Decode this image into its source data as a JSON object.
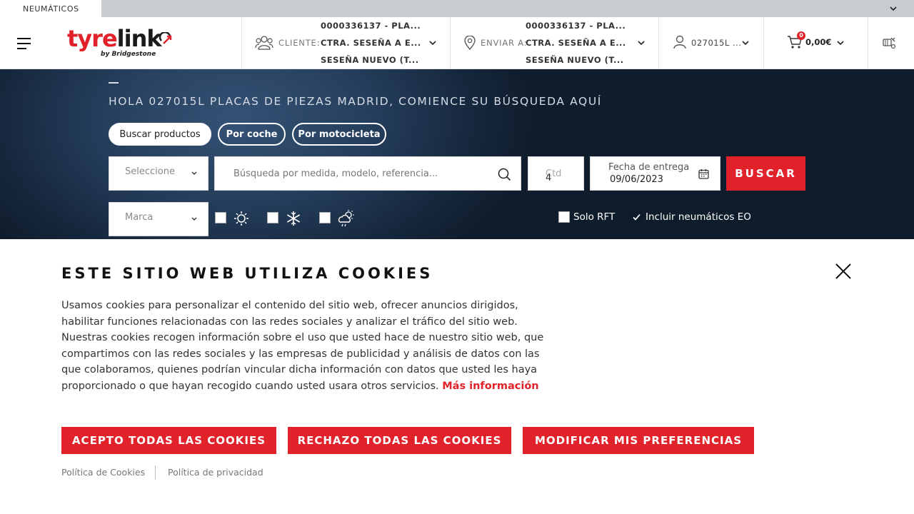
{
  "top_tab": "NEUMÁTICOS",
  "logo": {
    "tyre": "tyre",
    "link": "link",
    "sub": "by Bridgestone"
  },
  "client": {
    "label": "CLIENTE:",
    "line1": "0000336137 - PLA...",
    "line2": "CTRA. SESEÑA A E...",
    "line3": "SESEÑA NUEVO (T..."
  },
  "ship": {
    "label": "ENVIAR A:",
    "line1": "0000336137 - PLA...",
    "line2": "CTRA. SESEÑA A E...",
    "line3": "SESEÑA NUEVO (T..."
  },
  "user": {
    "name": "027015L ..."
  },
  "cart": {
    "count": "0",
    "amount": "0,00€"
  },
  "hero": {
    "greeting": "HOLA 027015L PLACAS DE PIEZAS MADRID, COMIENCE SU BÚSQUEDA AQUÍ",
    "tabs": [
      "Buscar productos",
      "Por coche",
      "Por motocicleta"
    ],
    "select_placeholder": "Seleccione",
    "search_placeholder": "Búsqueda por medida, modelo, referencia...",
    "qty_placeholder": "Ctd",
    "qty_value": "4",
    "date_label": "Fecha de entrega",
    "date_value": "09/06/2023",
    "search_button": "BUSCAR",
    "brand_placeholder": "Marca",
    "solo_rft": "Solo RFT",
    "include_eo": "Incluir neumáticos EO"
  },
  "cookie": {
    "title": "ESTE SITIO WEB UTILIZA COOKIES",
    "body": "Usamos cookies para personalizar el contenido del sitio web, ofrecer anuncios dirigidos, habilitar funciones relacionadas con las redes sociales y analizar el tráfico del sitio web. Nuestras cookies recogen información sobre el uso que usted hace de nuestro sitio web, que compartimos con las redes sociales y las empresas de publicidad y análisis de datos con las que colaboramos, quienes podrían vincular dicha información con datos que usted les haya proporcionado o que hayan recogido cuando usted usara otros servicios.",
    "more": "Más información",
    "accept": "ACEPTO TODAS LAS COOKIES",
    "reject": "RECHAZO TODAS LAS COOKIES",
    "modify": "MODIFICAR MIS PREFERENCIAS",
    "policy_cookies": "Política de Cookies",
    "policy_privacy": "Política de privacidad"
  },
  "colors": {
    "accent": "#e1222b",
    "hero_dark": "#16273c"
  }
}
